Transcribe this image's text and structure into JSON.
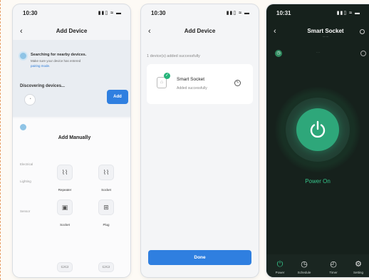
{
  "status": {
    "time_1": "10:30",
    "time_2": "10:30",
    "time_3": "10:31",
    "signal_icons": "▮▮▯ ≈ ▬"
  },
  "screen1": {
    "title": "Add Device",
    "searching": "Searching for nearby devices.",
    "hint_line1": "Make sure your device has entered",
    "hint_line2": "pairing mode.",
    "discovering": "Discovering devices...",
    "add_button": "Add",
    "manual_title": "Add Manually",
    "categories": [
      "Electrical",
      "Lighting",
      "Sensor"
    ],
    "tiles": [
      {
        "label": "Repeater",
        "icon": "switch-icon"
      },
      {
        "label": "Socket",
        "icon": "socket-icon"
      },
      {
        "label": "Socket",
        "icon": "socket-icon"
      },
      {
        "label": "Plug",
        "icon": "plug-icon"
      }
    ]
  },
  "screen2": {
    "title": "Add Device",
    "added_count": "1 device(s) added successfully",
    "device_name": "Smart Socket",
    "device_status": "Added successfully",
    "done_button": "Done"
  },
  "screen3": {
    "title": "Smart Socket",
    "power_state": "Power On",
    "nav": [
      {
        "label": "Power",
        "icon": "power-icon",
        "active": true
      },
      {
        "label": "Schedule",
        "icon": "clock-icon",
        "active": false
      },
      {
        "label": "Timer",
        "icon": "timer-icon",
        "active": false
      },
      {
        "label": "Setting",
        "icon": "gear-icon",
        "active": false
      }
    ]
  },
  "colors": {
    "accent_blue": "#2f7fe0",
    "accent_green": "#2ea77a",
    "dark_bg": "#16211c"
  }
}
